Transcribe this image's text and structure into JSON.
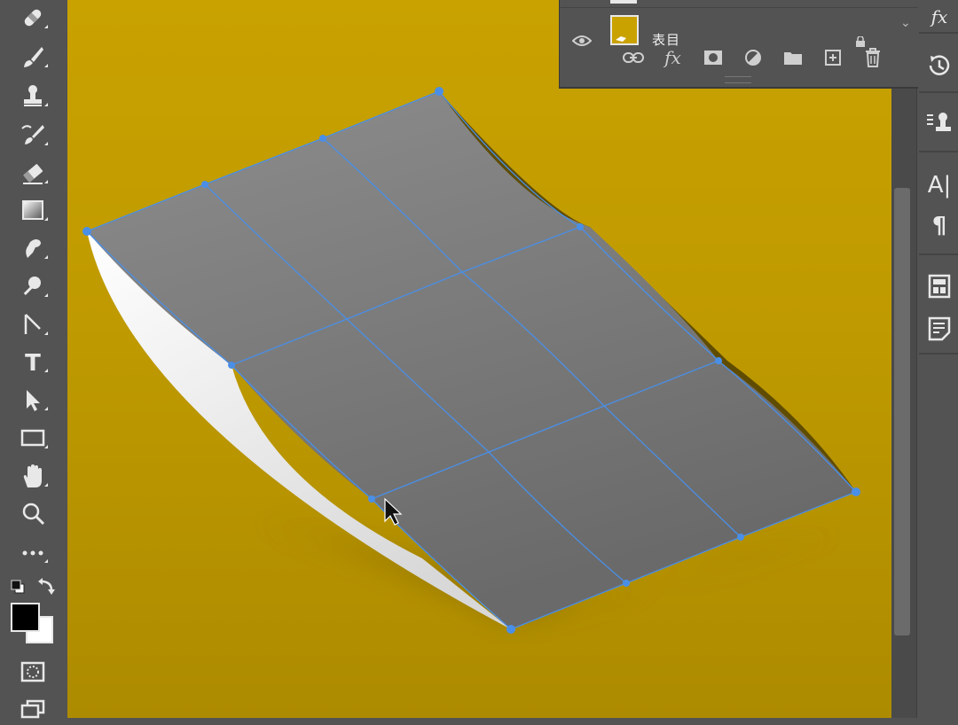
{
  "toolbar": {
    "tools": [
      {
        "name": "spot-healing-brush-tool",
        "icon": "bandage-icon"
      },
      {
        "name": "brush-tool",
        "icon": "brush-icon"
      },
      {
        "name": "clone-stamp-tool",
        "icon": "stamp-icon"
      },
      {
        "name": "history-brush-tool",
        "icon": "history-brush-icon"
      },
      {
        "name": "eraser-tool",
        "icon": "eraser-icon"
      },
      {
        "name": "gradient-tool",
        "icon": "gradient-icon"
      },
      {
        "name": "smudge-tool",
        "icon": "smudge-icon"
      },
      {
        "name": "dodge-tool",
        "icon": "dodge-icon"
      },
      {
        "name": "pen-tool",
        "icon": "pen-icon"
      },
      {
        "name": "type-tool",
        "icon": "type-icon",
        "glyph": "T"
      },
      {
        "name": "path-selection-tool",
        "icon": "arrow-icon"
      },
      {
        "name": "rectangle-tool",
        "icon": "rectangle-icon"
      },
      {
        "name": "hand-tool",
        "icon": "hand-icon"
      },
      {
        "name": "zoom-tool",
        "icon": "magnifier-icon"
      },
      {
        "name": "edit-toolbar",
        "icon": "ellipsis-icon",
        "glyph": "•••"
      }
    ],
    "foreground_color": "#000000",
    "background_color": "#ffffff"
  },
  "layers_panel": {
    "layer": {
      "name": "表目",
      "thumbnail_color": "#c9a200"
    },
    "buttons": [
      {
        "name": "link-layers",
        "icon": "link-icon"
      },
      {
        "name": "add-layer-style",
        "icon": "fx-icon",
        "glyph": "fx"
      },
      {
        "name": "add-mask",
        "icon": "mask-icon"
      },
      {
        "name": "adjustment-layer",
        "icon": "adjustment-icon"
      },
      {
        "name": "new-group",
        "icon": "folder-icon"
      },
      {
        "name": "new-layer",
        "icon": "new-layer-icon"
      },
      {
        "name": "delete-layer",
        "icon": "trash-icon"
      }
    ]
  },
  "right_strip": {
    "icons": [
      {
        "name": "styles",
        "icon": "fx-icon",
        "glyph": "fx"
      },
      {
        "name": "history",
        "icon": "history-icon"
      },
      {
        "name": "clone-source",
        "icon": "clone-source-icon"
      },
      {
        "name": "character",
        "icon": "character-icon",
        "glyph": "A|"
      },
      {
        "name": "paragraph",
        "icon": "paragraph-icon",
        "glyph": "¶"
      },
      {
        "name": "properties",
        "icon": "properties-icon"
      },
      {
        "name": "notes",
        "icon": "notes-icon"
      }
    ]
  },
  "canvas": {
    "background_color": "#c9a200",
    "surface_color": "#7a7a7a",
    "selection_color": "#4a8fe7"
  }
}
